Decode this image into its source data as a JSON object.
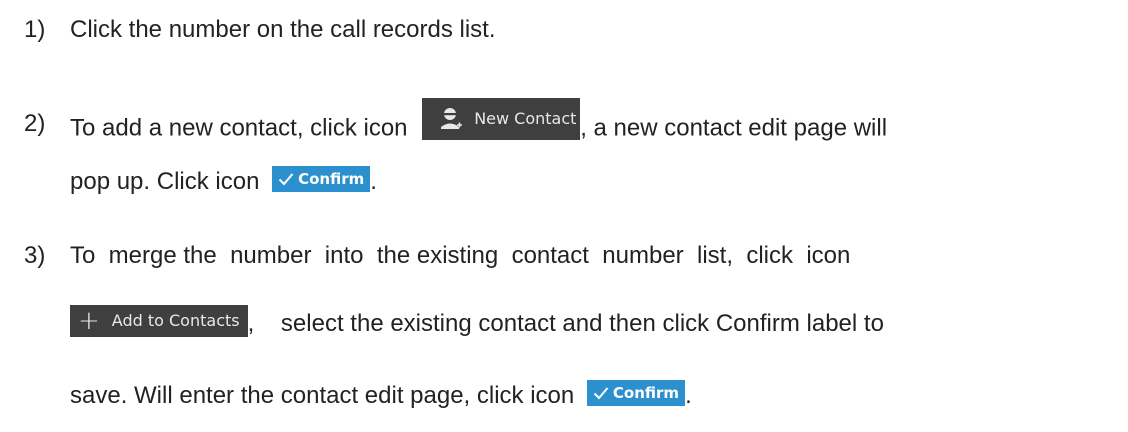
{
  "steps": [
    {
      "num": "1)",
      "text": "Click the number on the call records list."
    },
    {
      "num": "2)",
      "text_a": "To add a new contact, click icon",
      "text_b": ", a new contact edit page will",
      "text_c": "pop up.   Click icon"
    },
    {
      "num": "3)",
      "text_a": "To  merge the  number  into  the existing  contact  number  list,  click  icon",
      "text_b": ",    select the existing contact and then click Confirm label to",
      "text_c": "save. Will enter the contact edit page, click icon"
    }
  ],
  "buttons": {
    "new_contact": "New Contact",
    "confirm": "Confirm",
    "add_to_contacts": "Add to Contacts"
  },
  "punct": {
    "period": "."
  },
  "icons": {
    "new_contact": "add-person-icon",
    "confirm": "checkmark-icon",
    "add_to_contacts": "plus-icon"
  },
  "colors": {
    "text": "#222222",
    "dark_button": "#3f3f3f",
    "confirm_button": "#2b90cd"
  }
}
